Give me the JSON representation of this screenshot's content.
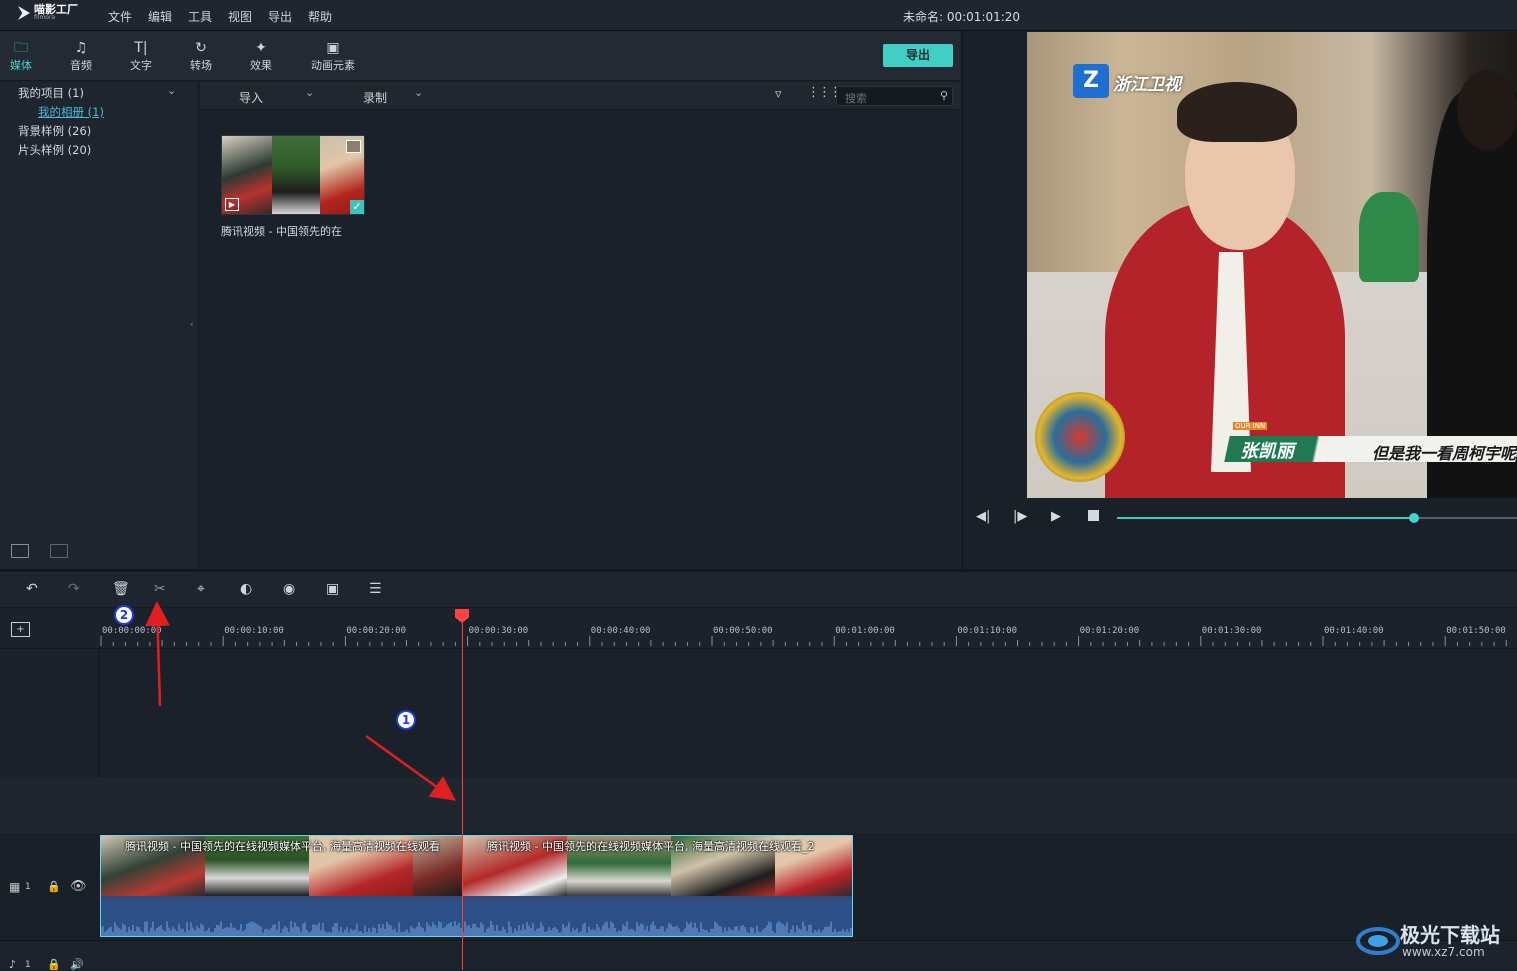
{
  "app": {
    "logo_name": "喵影工厂",
    "logo_sub": "filmora",
    "document_title": "未命名: 00:01:01:20"
  },
  "menu": [
    "文件",
    "编辑",
    "工具",
    "视图",
    "导出",
    "帮助"
  ],
  "library_tabs": [
    {
      "label": "媒体",
      "icon": "folder-icon",
      "active": true
    },
    {
      "label": "音频",
      "icon": "music-note-icon"
    },
    {
      "label": "文字",
      "icon": "text-icon"
    },
    {
      "label": "转场",
      "icon": "transition-icon"
    },
    {
      "label": "效果",
      "icon": "effects-icon"
    },
    {
      "label": "动画元素",
      "icon": "image-icon"
    }
  ],
  "export_label": "导出",
  "sidebar": {
    "items": [
      "我的项目 (1)",
      "背景样例 (26)",
      "片头样例 (20)"
    ],
    "sub_item": "我的相册 (1)"
  },
  "media_toolbar": {
    "import_label": "导入",
    "record_label": "录制",
    "search_placeholder": "搜索"
  },
  "media_items": [
    {
      "caption": "腾讯视频 - 中国领先的在"
    }
  ],
  "preview": {
    "channel_logo": "浙江卫视",
    "caption_tag": "OUR INN",
    "caption_name": "张凯丽",
    "caption_line": "但是我一看周柯宇呢",
    "progress": 0.74
  },
  "timeline": {
    "ruler_labels": [
      "00:00:00:00",
      "00:00:10:00",
      "00:00:20:00",
      "00:00:30:00",
      "00:00:40:00",
      "00:00:50:00",
      "00:01:00:00",
      "00:01:10:00",
      "00:01:20:00",
      "00:01:30:00",
      "00:01:40:00",
      "00:01:50:00"
    ],
    "clips": [
      {
        "title": "腾讯视频 - 中国领先的在线视频媒体平台, 海量高清视频在线观看"
      },
      {
        "title": "腾讯视频 - 中国领先的在线视频媒体平台, 海量高清视频在线观看_2"
      }
    ],
    "video_track_number": "1",
    "audio_track_number": "1"
  },
  "annotations": {
    "badge_1": "1",
    "badge_2": "2"
  },
  "watermark": {
    "name": "极光下载站",
    "url": "www.xz7.com"
  },
  "colors": {
    "accent": "#41cfc5",
    "playhead": "#ff3b3b",
    "clip_border": "#6ad4f4",
    "arrow": "#e02020"
  }
}
